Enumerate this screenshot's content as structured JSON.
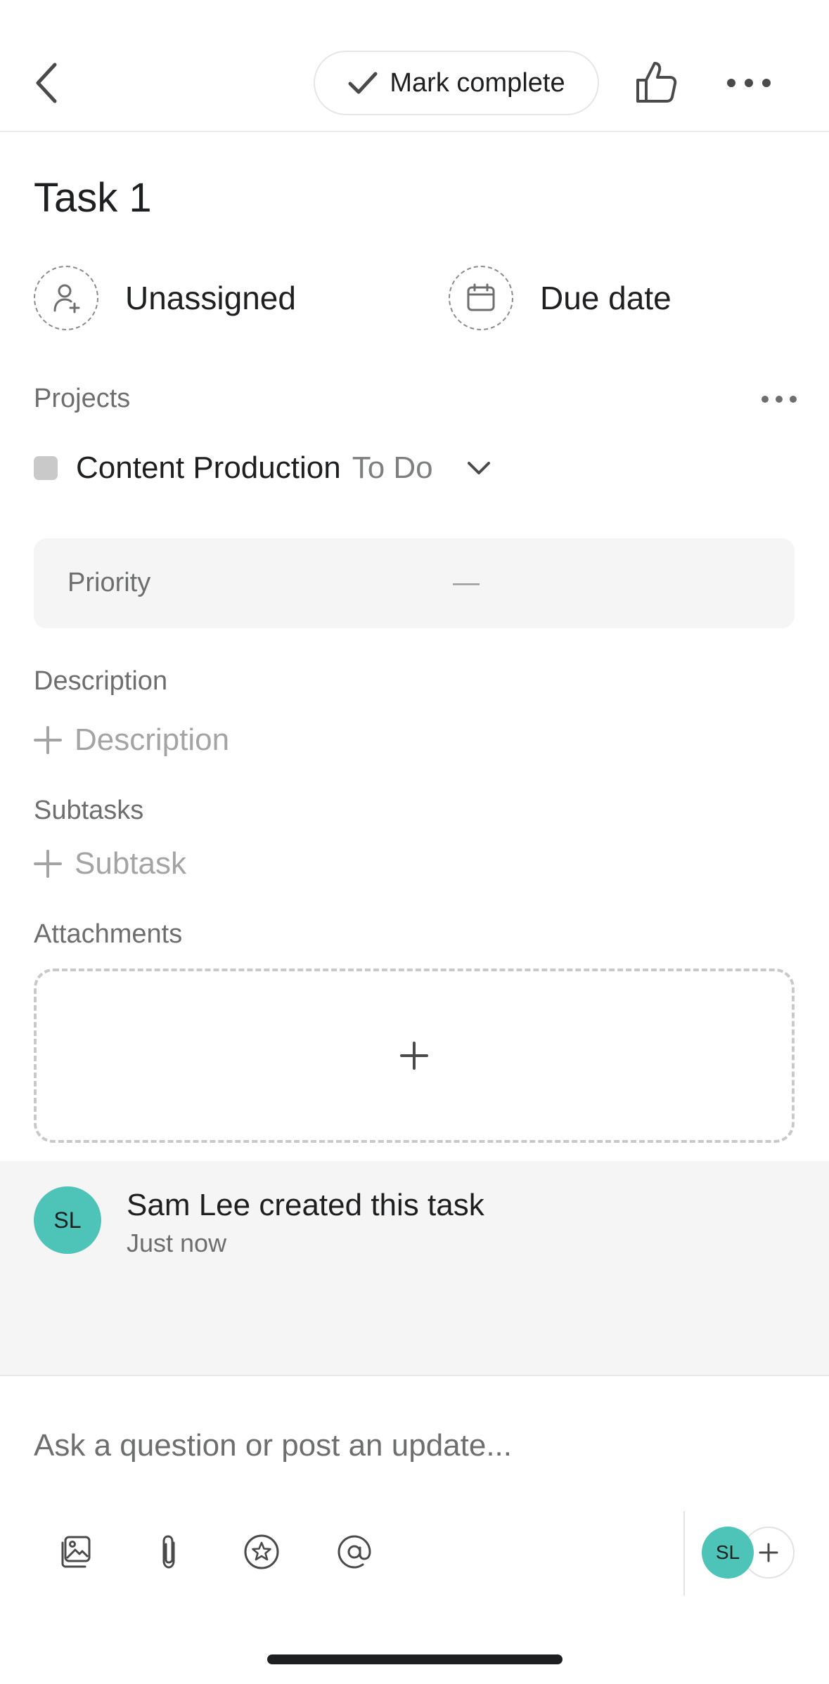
{
  "header": {
    "back": "back",
    "mark_complete_label": "Mark complete"
  },
  "task": {
    "title": "Task 1",
    "assignee_label": "Unassigned",
    "due_date_label": "Due date"
  },
  "projects": {
    "label": "Projects",
    "items": [
      {
        "name": "Content Production",
        "section": "To Do"
      }
    ]
  },
  "fields": {
    "priority_label": "Priority",
    "priority_value": "—"
  },
  "description": {
    "label": "Description",
    "add_placeholder": "Description"
  },
  "subtasks": {
    "label": "Subtasks",
    "add_placeholder": "Subtask"
  },
  "attachments": {
    "label": "Attachments",
    "add_symbol": "+"
  },
  "activity": {
    "avatar_initials": "SL",
    "text": "Sam Lee created this task",
    "time": "Just now"
  },
  "composer": {
    "placeholder": "Ask a question or post an update...",
    "collaborator_initials": "SL",
    "add_collaborator_symbol": "+"
  },
  "colors": {
    "avatar": "#4ec3b7",
    "project_square": "#c9c9c9",
    "panel_bg": "#f6f5f5"
  },
  "icons": {
    "back": "chevron-left-icon",
    "check": "check-icon",
    "like": "thumbs-up-icon",
    "more": "more-horizontal-icon",
    "assignee": "user-plus-icon",
    "due_date": "calendar-icon",
    "dropdown": "chevron-down-icon",
    "add": "plus-icon",
    "image": "image-icon",
    "attach": "paperclip-icon",
    "star": "star-icon",
    "mention": "at-sign-icon"
  }
}
